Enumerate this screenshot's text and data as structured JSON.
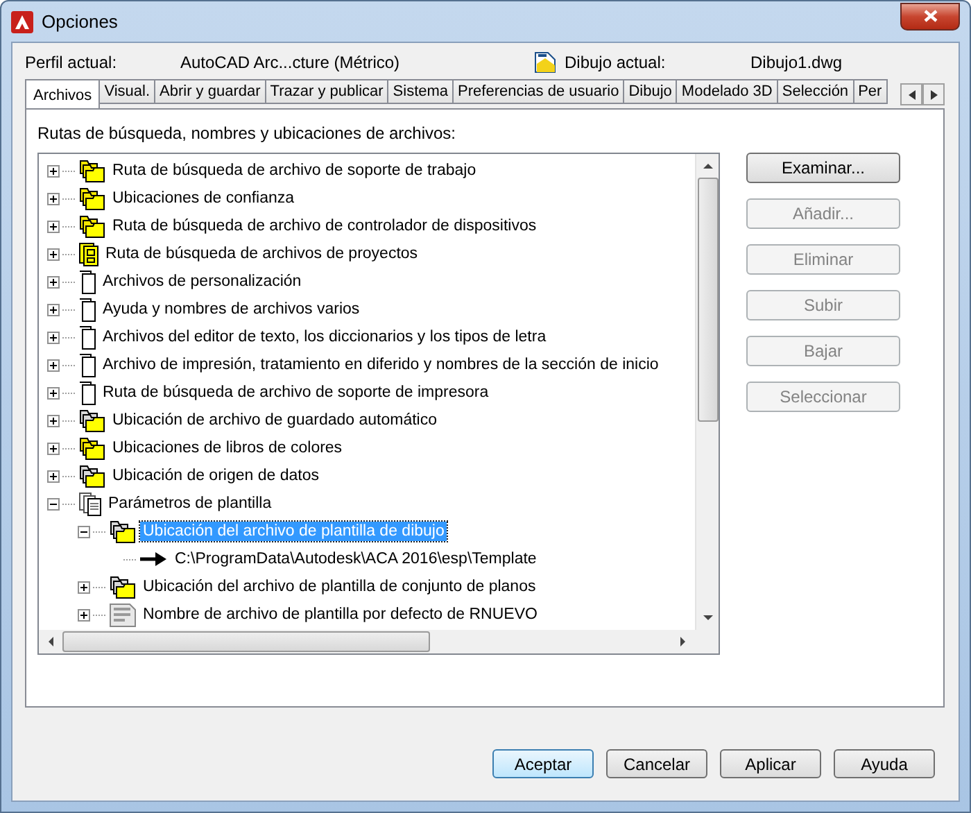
{
  "window": {
    "title": "Opciones"
  },
  "profile": {
    "label": "Perfil actual:",
    "value": "AutoCAD Arc...cture (Métrico)",
    "drawing_label": "Dibujo actual:",
    "drawing_value": "Dibujo1.dwg"
  },
  "tabs": [
    {
      "label": "Archivos",
      "selected": true
    },
    {
      "label": "Visual.",
      "selected": false
    },
    {
      "label": "Abrir y guardar",
      "selected": false
    },
    {
      "label": "Trazar y publicar",
      "selected": false
    },
    {
      "label": "Sistema",
      "selected": false
    },
    {
      "label": "Preferencias de usuario",
      "selected": false
    },
    {
      "label": "Dibujo",
      "selected": false
    },
    {
      "label": "Modelado 3D",
      "selected": false
    },
    {
      "label": "Selección",
      "selected": false
    },
    {
      "label": "Per",
      "selected": false
    }
  ],
  "panel": {
    "heading": "Rutas de búsqueda, nombres y ubicaciones de archivos:"
  },
  "tree": [
    {
      "label": "Ruta de búsqueda de archivo de soporte de trabajo",
      "kind": "folders",
      "expanded": false,
      "selected": false
    },
    {
      "label": "Ubicaciones de confianza",
      "kind": "folders",
      "expanded": false,
      "selected": false
    },
    {
      "label": "Ruta de búsqueda de archivo de controlador de dispositivos",
      "kind": "folders",
      "expanded": false,
      "selected": false
    },
    {
      "label": "Ruta de búsqueda de archivos de proyectos",
      "kind": "project",
      "expanded": false,
      "selected": false
    },
    {
      "label": "Archivos de personalización",
      "kind": "doc",
      "expanded": false,
      "selected": false
    },
    {
      "label": "Ayuda y nombres de archivos varios",
      "kind": "doc",
      "expanded": false,
      "selected": false
    },
    {
      "label": "Archivos del editor de texto, los diccionarios y los tipos de letra",
      "kind": "doc",
      "expanded": false,
      "selected": false
    },
    {
      "label": "Archivo de impresión, tratamiento en diferido y nombres de la sección de inicio",
      "kind": "doc",
      "expanded": false,
      "selected": false
    },
    {
      "label": "Ruta de búsqueda de archivo de soporte de impresora",
      "kind": "doc",
      "expanded": false,
      "selected": false
    },
    {
      "label": "Ubicación de archivo de guardado automático",
      "kind": "folders-dark",
      "expanded": false,
      "selected": false
    },
    {
      "label": "Ubicaciones de libros de colores",
      "kind": "folders",
      "expanded": false,
      "selected": false
    },
    {
      "label": "Ubicación de origen de datos",
      "kind": "folders-dark",
      "expanded": false,
      "selected": false
    },
    {
      "label": "Parámetros de plantilla",
      "kind": "docs",
      "expanded": true,
      "selected": false,
      "children": [
        {
          "label": "Ubicación del archivo de plantilla de dibujo",
          "kind": "folders-dark",
          "expanded": true,
          "selected": true,
          "children": [
            {
              "label": "C:\\ProgramData\\Autodesk\\ACA 2016\\esp\\Template",
              "kind": "path",
              "selected": false
            }
          ]
        },
        {
          "label": "Ubicación del archivo de plantilla de conjunto de planos",
          "kind": "folders-dark",
          "expanded": false,
          "selected": false
        },
        {
          "label": "Nombre de archivo de plantilla por defecto de RNUEVO",
          "kind": "dwt",
          "expanded": false,
          "selected": false
        }
      ]
    }
  ],
  "side_buttons": [
    {
      "label": "Examinar...",
      "disabled": false
    },
    {
      "label": "Añadir...",
      "disabled": true
    },
    {
      "label": "Eliminar",
      "disabled": true
    },
    {
      "label": "Subir",
      "disabled": true
    },
    {
      "label": "Bajar",
      "disabled": true
    },
    {
      "label": "Seleccionar",
      "disabled": true
    }
  ],
  "footer_buttons": [
    {
      "label": "Aceptar",
      "default": true
    },
    {
      "label": "Cancelar",
      "default": false
    },
    {
      "label": "Aplicar",
      "default": false
    },
    {
      "label": "Ayuda",
      "default": false
    }
  ]
}
